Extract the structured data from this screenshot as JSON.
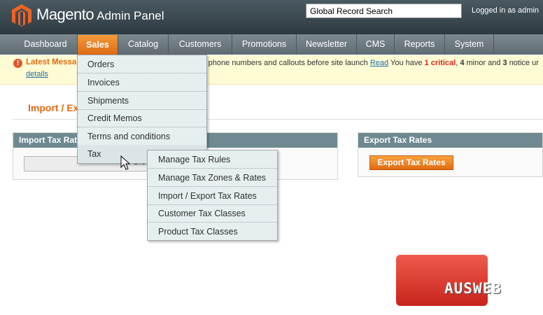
{
  "header": {
    "brand_name": "Magento",
    "brand_sub": "Admin Panel",
    "search_value": "Global Record Search",
    "logged_in": "Logged in as admin"
  },
  "nav": [
    {
      "label": "Dashboard",
      "active": false
    },
    {
      "label": "Sales",
      "active": true
    },
    {
      "label": "Catalog",
      "active": false
    },
    {
      "label": "Customers",
      "active": false
    },
    {
      "label": "Promotions",
      "active": false
    },
    {
      "label": "Newsletter",
      "active": false
    },
    {
      "label": "CMS",
      "active": false
    },
    {
      "label": "Reports",
      "active": false
    },
    {
      "label": "System",
      "active": false
    }
  ],
  "message": {
    "label": "Latest Messa",
    "text_prefix": "ult phone numbers and callouts before site launch",
    "read_link": "Read",
    "text_you_have": "You have",
    "critical_count": "1",
    "critical_label": "critical",
    "minor_count": "4",
    "minor_label": "minor and",
    "notice_count": "3",
    "notice_label": "notice ur",
    "details_link": "details"
  },
  "page": {
    "title": "Import / Ex",
    "import_box_title": "Import Tax Rat",
    "browse_label": "Bro",
    "export_box_title": "Export Tax Rates",
    "export_button": "Export Tax Rates"
  },
  "sales_menu": [
    "Orders",
    "Invoices",
    "Shipments",
    "Credit Memos",
    "Terms and conditions",
    "Tax"
  ],
  "tax_submenu": [
    "Manage Tax Rules",
    "Manage Tax Zones & Rates",
    "Import / Export Tax Rates",
    "Customer Tax Classes",
    "Product Tax Classes"
  ],
  "watermark": "AUSWEB",
  "colors": {
    "accent_orange": "#e36c14",
    "nav_bg": "#6b777d",
    "header_bg": "#3a474d"
  }
}
